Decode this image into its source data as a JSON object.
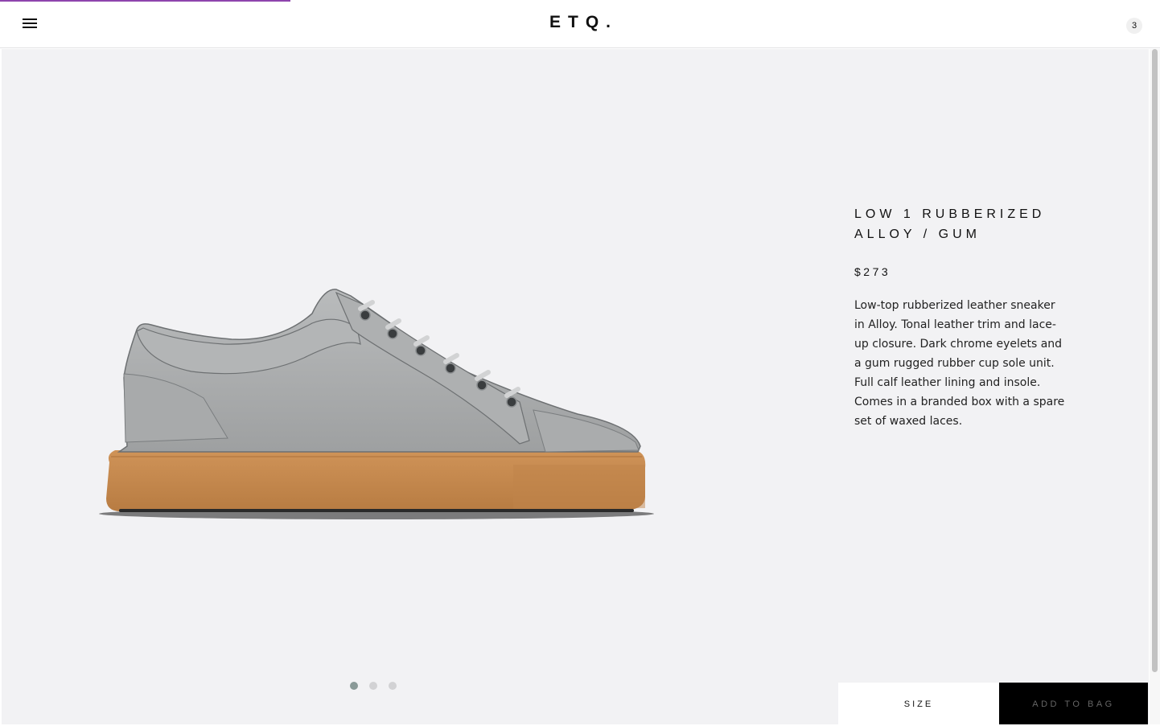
{
  "header": {
    "logo": "ETQ.",
    "cart_count": "3"
  },
  "page_load_progress": 0.25,
  "product": {
    "title_line1": "LOW 1 RUBBERIZED",
    "title_line2": "ALLOY / GUM",
    "price": "$273",
    "description": "Low-top rubberized leather sneaker in Alloy. Tonal leather trim and lace-up closure. Dark chrome eyelets and a gum rugged rubber cup sole unit. Full calf leather lining and insole. Comes in a branded box with a spare set of waxed laces."
  },
  "gallery": {
    "image_count": 3,
    "active_index": 0
  },
  "actions": {
    "size_label": "SIZE",
    "add_to_bag_label": "ADD TO BAG"
  },
  "colors": {
    "background": "#f2f2f4",
    "shoe_upper": "#a9abac",
    "sole": "#c4884e",
    "button_dark": "#000000",
    "progress": "#8e44ad"
  },
  "icons": {
    "menu": "hamburger-icon"
  }
}
